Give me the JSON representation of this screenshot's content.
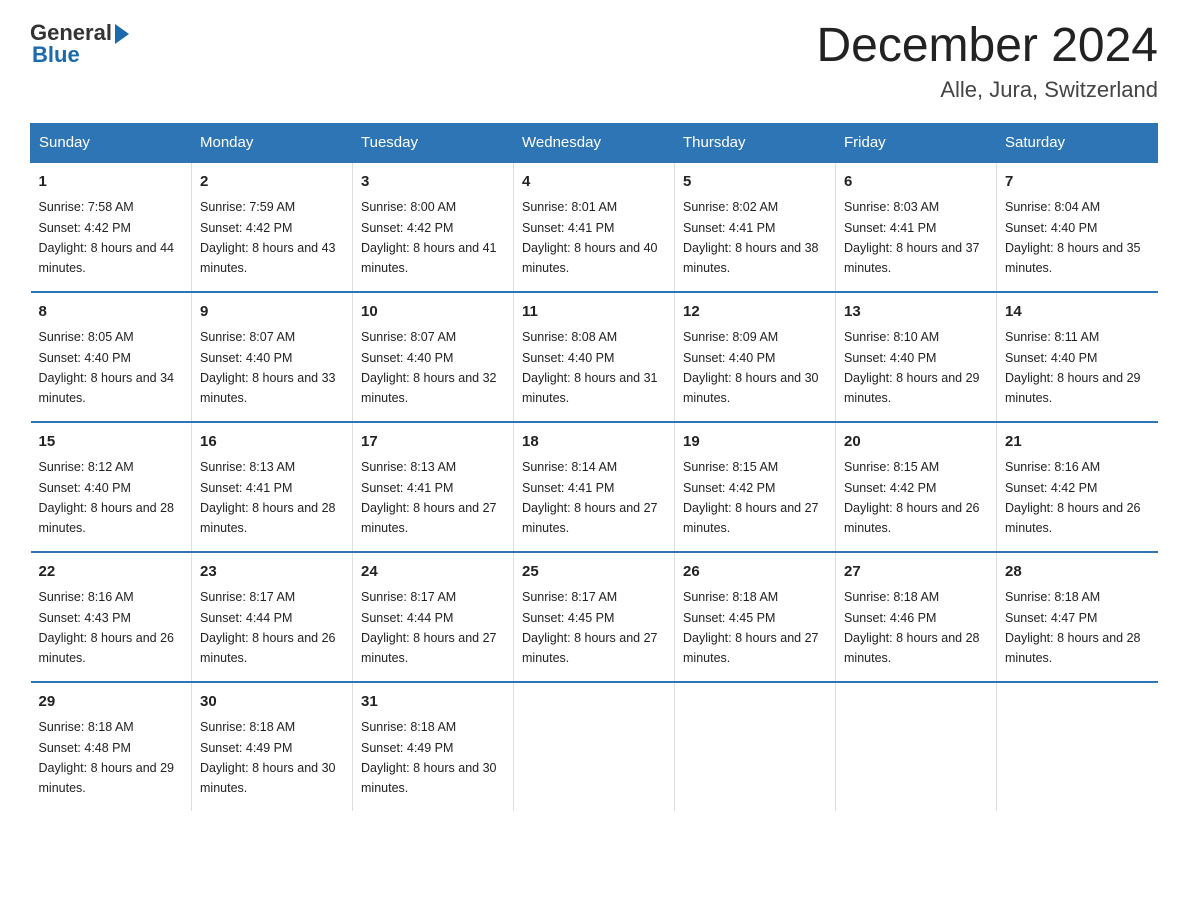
{
  "header": {
    "logo_general": "General",
    "logo_blue": "Blue",
    "month_title": "December 2024",
    "location": "Alle, Jura, Switzerland"
  },
  "days_of_week": [
    "Sunday",
    "Monday",
    "Tuesday",
    "Wednesday",
    "Thursday",
    "Friday",
    "Saturday"
  ],
  "weeks": [
    [
      {
        "day": "1",
        "sunrise": "7:58 AM",
        "sunset": "4:42 PM",
        "daylight": "8 hours and 44 minutes."
      },
      {
        "day": "2",
        "sunrise": "7:59 AM",
        "sunset": "4:42 PM",
        "daylight": "8 hours and 43 minutes."
      },
      {
        "day": "3",
        "sunrise": "8:00 AM",
        "sunset": "4:42 PM",
        "daylight": "8 hours and 41 minutes."
      },
      {
        "day": "4",
        "sunrise": "8:01 AM",
        "sunset": "4:41 PM",
        "daylight": "8 hours and 40 minutes."
      },
      {
        "day": "5",
        "sunrise": "8:02 AM",
        "sunset": "4:41 PM",
        "daylight": "8 hours and 38 minutes."
      },
      {
        "day": "6",
        "sunrise": "8:03 AM",
        "sunset": "4:41 PM",
        "daylight": "8 hours and 37 minutes."
      },
      {
        "day": "7",
        "sunrise": "8:04 AM",
        "sunset": "4:40 PM",
        "daylight": "8 hours and 35 minutes."
      }
    ],
    [
      {
        "day": "8",
        "sunrise": "8:05 AM",
        "sunset": "4:40 PM",
        "daylight": "8 hours and 34 minutes."
      },
      {
        "day": "9",
        "sunrise": "8:07 AM",
        "sunset": "4:40 PM",
        "daylight": "8 hours and 33 minutes."
      },
      {
        "day": "10",
        "sunrise": "8:07 AM",
        "sunset": "4:40 PM",
        "daylight": "8 hours and 32 minutes."
      },
      {
        "day": "11",
        "sunrise": "8:08 AM",
        "sunset": "4:40 PM",
        "daylight": "8 hours and 31 minutes."
      },
      {
        "day": "12",
        "sunrise": "8:09 AM",
        "sunset": "4:40 PM",
        "daylight": "8 hours and 30 minutes."
      },
      {
        "day": "13",
        "sunrise": "8:10 AM",
        "sunset": "4:40 PM",
        "daylight": "8 hours and 29 minutes."
      },
      {
        "day": "14",
        "sunrise": "8:11 AM",
        "sunset": "4:40 PM",
        "daylight": "8 hours and 29 minutes."
      }
    ],
    [
      {
        "day": "15",
        "sunrise": "8:12 AM",
        "sunset": "4:40 PM",
        "daylight": "8 hours and 28 minutes."
      },
      {
        "day": "16",
        "sunrise": "8:13 AM",
        "sunset": "4:41 PM",
        "daylight": "8 hours and 28 minutes."
      },
      {
        "day": "17",
        "sunrise": "8:13 AM",
        "sunset": "4:41 PM",
        "daylight": "8 hours and 27 minutes."
      },
      {
        "day": "18",
        "sunrise": "8:14 AM",
        "sunset": "4:41 PM",
        "daylight": "8 hours and 27 minutes."
      },
      {
        "day": "19",
        "sunrise": "8:15 AM",
        "sunset": "4:42 PM",
        "daylight": "8 hours and 27 minutes."
      },
      {
        "day": "20",
        "sunrise": "8:15 AM",
        "sunset": "4:42 PM",
        "daylight": "8 hours and 26 minutes."
      },
      {
        "day": "21",
        "sunrise": "8:16 AM",
        "sunset": "4:42 PM",
        "daylight": "8 hours and 26 minutes."
      }
    ],
    [
      {
        "day": "22",
        "sunrise": "8:16 AM",
        "sunset": "4:43 PM",
        "daylight": "8 hours and 26 minutes."
      },
      {
        "day": "23",
        "sunrise": "8:17 AM",
        "sunset": "4:44 PM",
        "daylight": "8 hours and 26 minutes."
      },
      {
        "day": "24",
        "sunrise": "8:17 AM",
        "sunset": "4:44 PM",
        "daylight": "8 hours and 27 minutes."
      },
      {
        "day": "25",
        "sunrise": "8:17 AM",
        "sunset": "4:45 PM",
        "daylight": "8 hours and 27 minutes."
      },
      {
        "day": "26",
        "sunrise": "8:18 AM",
        "sunset": "4:45 PM",
        "daylight": "8 hours and 27 minutes."
      },
      {
        "day": "27",
        "sunrise": "8:18 AM",
        "sunset": "4:46 PM",
        "daylight": "8 hours and 28 minutes."
      },
      {
        "day": "28",
        "sunrise": "8:18 AM",
        "sunset": "4:47 PM",
        "daylight": "8 hours and 28 minutes."
      }
    ],
    [
      {
        "day": "29",
        "sunrise": "8:18 AM",
        "sunset": "4:48 PM",
        "daylight": "8 hours and 29 minutes."
      },
      {
        "day": "30",
        "sunrise": "8:18 AM",
        "sunset": "4:49 PM",
        "daylight": "8 hours and 30 minutes."
      },
      {
        "day": "31",
        "sunrise": "8:18 AM",
        "sunset": "4:49 PM",
        "daylight": "8 hours and 30 minutes."
      },
      null,
      null,
      null,
      null
    ]
  ]
}
